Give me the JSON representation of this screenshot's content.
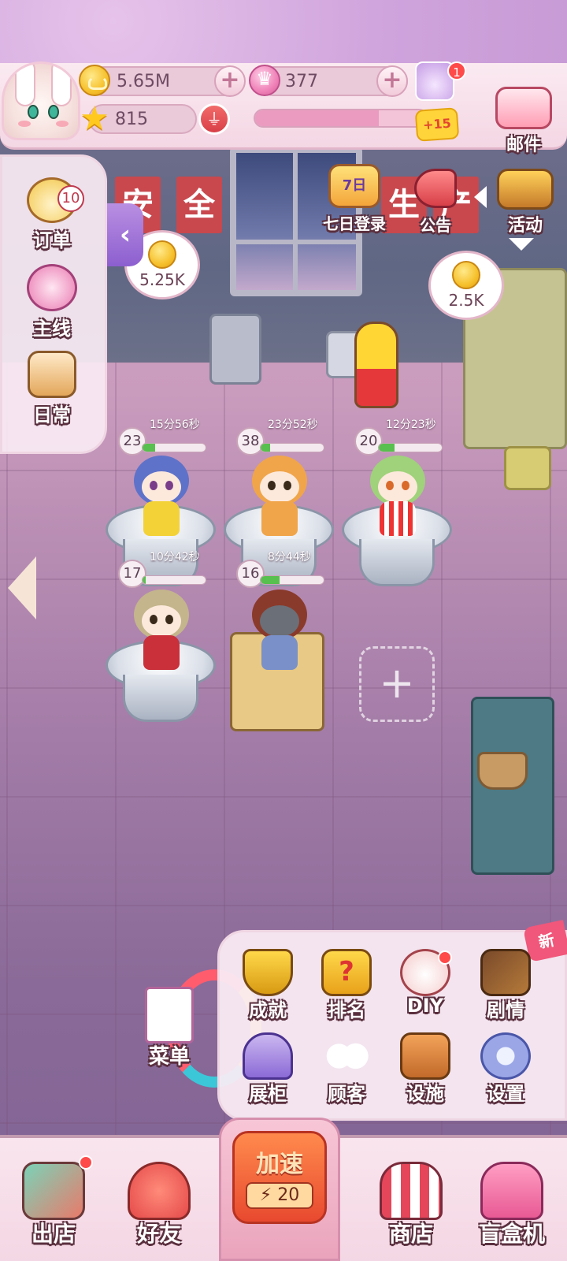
{
  "hud": {
    "coins": "5.65M",
    "gems": "377",
    "stars": "815",
    "level_bonus": "+15",
    "friend_badge": "1",
    "xp_progress": 0.72
  },
  "top_right": {
    "mail": "邮件",
    "events": "活动",
    "announcement": "公告",
    "seven_day_login": "七日登录",
    "seven_day_icon_text": "7日"
  },
  "left_menu": {
    "orders": "订单",
    "orders_badge": "10",
    "main_quest": "主线",
    "daily": "日常"
  },
  "wall_banners": [
    "安",
    "全",
    "生",
    "产"
  ],
  "bubbles": {
    "left": "5.25K",
    "right": "2.5K"
  },
  "stations": [
    {
      "level": "23",
      "timer": "15分56秒",
      "progress": 0.2
    },
    {
      "level": "38",
      "timer": "23分52秒",
      "progress": 0.15
    },
    {
      "level": "20",
      "timer": "12分23秒",
      "progress": 0.25
    },
    {
      "level": "17",
      "timer": "10分42秒",
      "progress": 0.05
    },
    {
      "level": "16",
      "timer": "8分44秒",
      "progress": 0.3
    }
  ],
  "empty_slot_symbol": "+",
  "menu_panel": {
    "new_tag": "新",
    "items": [
      "成就",
      "排名",
      "DIY",
      "剧情",
      "展柜",
      "顾客",
      "设施",
      "设置"
    ],
    "recipe_menu": "菜单"
  },
  "bottom_bar": {
    "go_out": "出店",
    "friends": "好友",
    "speed_title": "加速",
    "speed_count": "20",
    "shop": "商店",
    "blind_box": "盲盒机"
  },
  "colors": {
    "accent_pink": "#e3b6c9",
    "progress_green": "#58c04e",
    "badge_red": "#ff4a4a",
    "speed_orange": "#e8492f"
  },
  "icons": [
    "coin-icon",
    "crown-icon",
    "star-icon",
    "broom-icon",
    "mail-icon",
    "treasure-chest-icon",
    "megaphone-icon",
    "trophy-icon",
    "question-icon",
    "gear-icon"
  ]
}
